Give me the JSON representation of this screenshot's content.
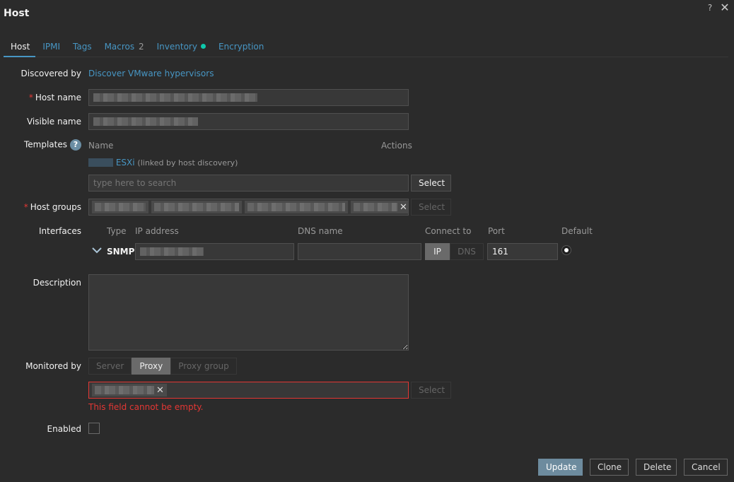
{
  "window": {
    "title": "Host",
    "help": "?",
    "close": "✕"
  },
  "tabs": [
    {
      "label": "Host"
    },
    {
      "label": "IPMI"
    },
    {
      "label": "Tags"
    },
    {
      "label": "Macros",
      "count": "2"
    },
    {
      "label": "Inventory"
    },
    {
      "label": "Encryption"
    }
  ],
  "form": {
    "discovered_by": {
      "label": "Discovered by",
      "value": "Discover VMware hypervisors"
    },
    "host_name": {
      "label": "Host name"
    },
    "visible_name": {
      "label": "Visible name"
    },
    "templates": {
      "label": "Templates",
      "col_name": "Name",
      "col_actions": "Actions",
      "item_name": "ESXi",
      "item_note": "(linked by host discovery)",
      "search_placeholder": "type here to search",
      "select_label": "Select"
    },
    "host_groups": {
      "label": "Host groups",
      "select_label": "Select"
    },
    "interfaces": {
      "label": "Interfaces",
      "col_type": "Type",
      "col_ip": "IP address",
      "col_dns": "DNS name",
      "col_connect": "Connect to",
      "col_port": "Port",
      "col_default": "Default",
      "row_type": "SNMP",
      "connect_ip": "IP",
      "connect_dns": "DNS",
      "port": "161"
    },
    "description": {
      "label": "Description"
    },
    "monitored_by": {
      "label": "Monitored by",
      "options": [
        "Server",
        "Proxy",
        "Proxy group"
      ],
      "selected": "Proxy",
      "select_label": "Select",
      "error": "This field cannot be empty."
    },
    "enabled": {
      "label": "Enabled"
    }
  },
  "footer": {
    "update": "Update",
    "clone": "Clone",
    "delete": "Delete",
    "cancel": "Cancel"
  }
}
